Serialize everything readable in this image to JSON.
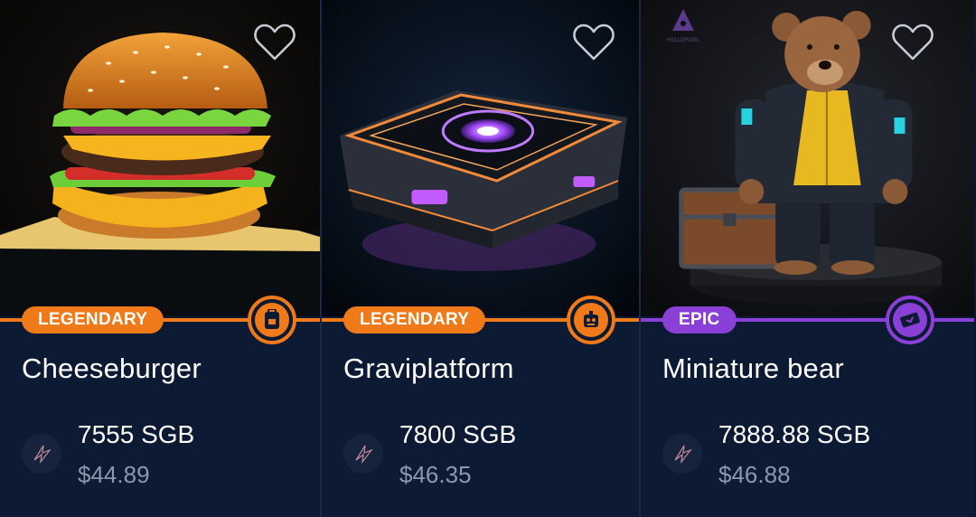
{
  "colors": {
    "legendary": "#f07a1a",
    "epic": "#8a3fd6",
    "background": "#0d1a33",
    "price_secondary": "#8c96ad"
  },
  "cards": [
    {
      "name": "Cheeseburger",
      "rarity": "LEGENDARY",
      "price_sgb": "7555 SGB",
      "price_usd": "$44.89",
      "image": "cheeseburger-art",
      "type_icon": "backpack-icon"
    },
    {
      "name": "Graviplatform",
      "rarity": "LEGENDARY",
      "price_sgb": "7800 SGB",
      "price_usd": "$46.35",
      "image": "graviplatform-art",
      "type_icon": "robot-icon"
    },
    {
      "name": "Miniature bear",
      "rarity": "EPIC",
      "price_sgb": "7888.88 SGB",
      "price_usd": "$46.88",
      "image": "miniature-bear-art",
      "type_icon": "ticket-icon",
      "watermark": "HELLOPIXEL"
    }
  ]
}
